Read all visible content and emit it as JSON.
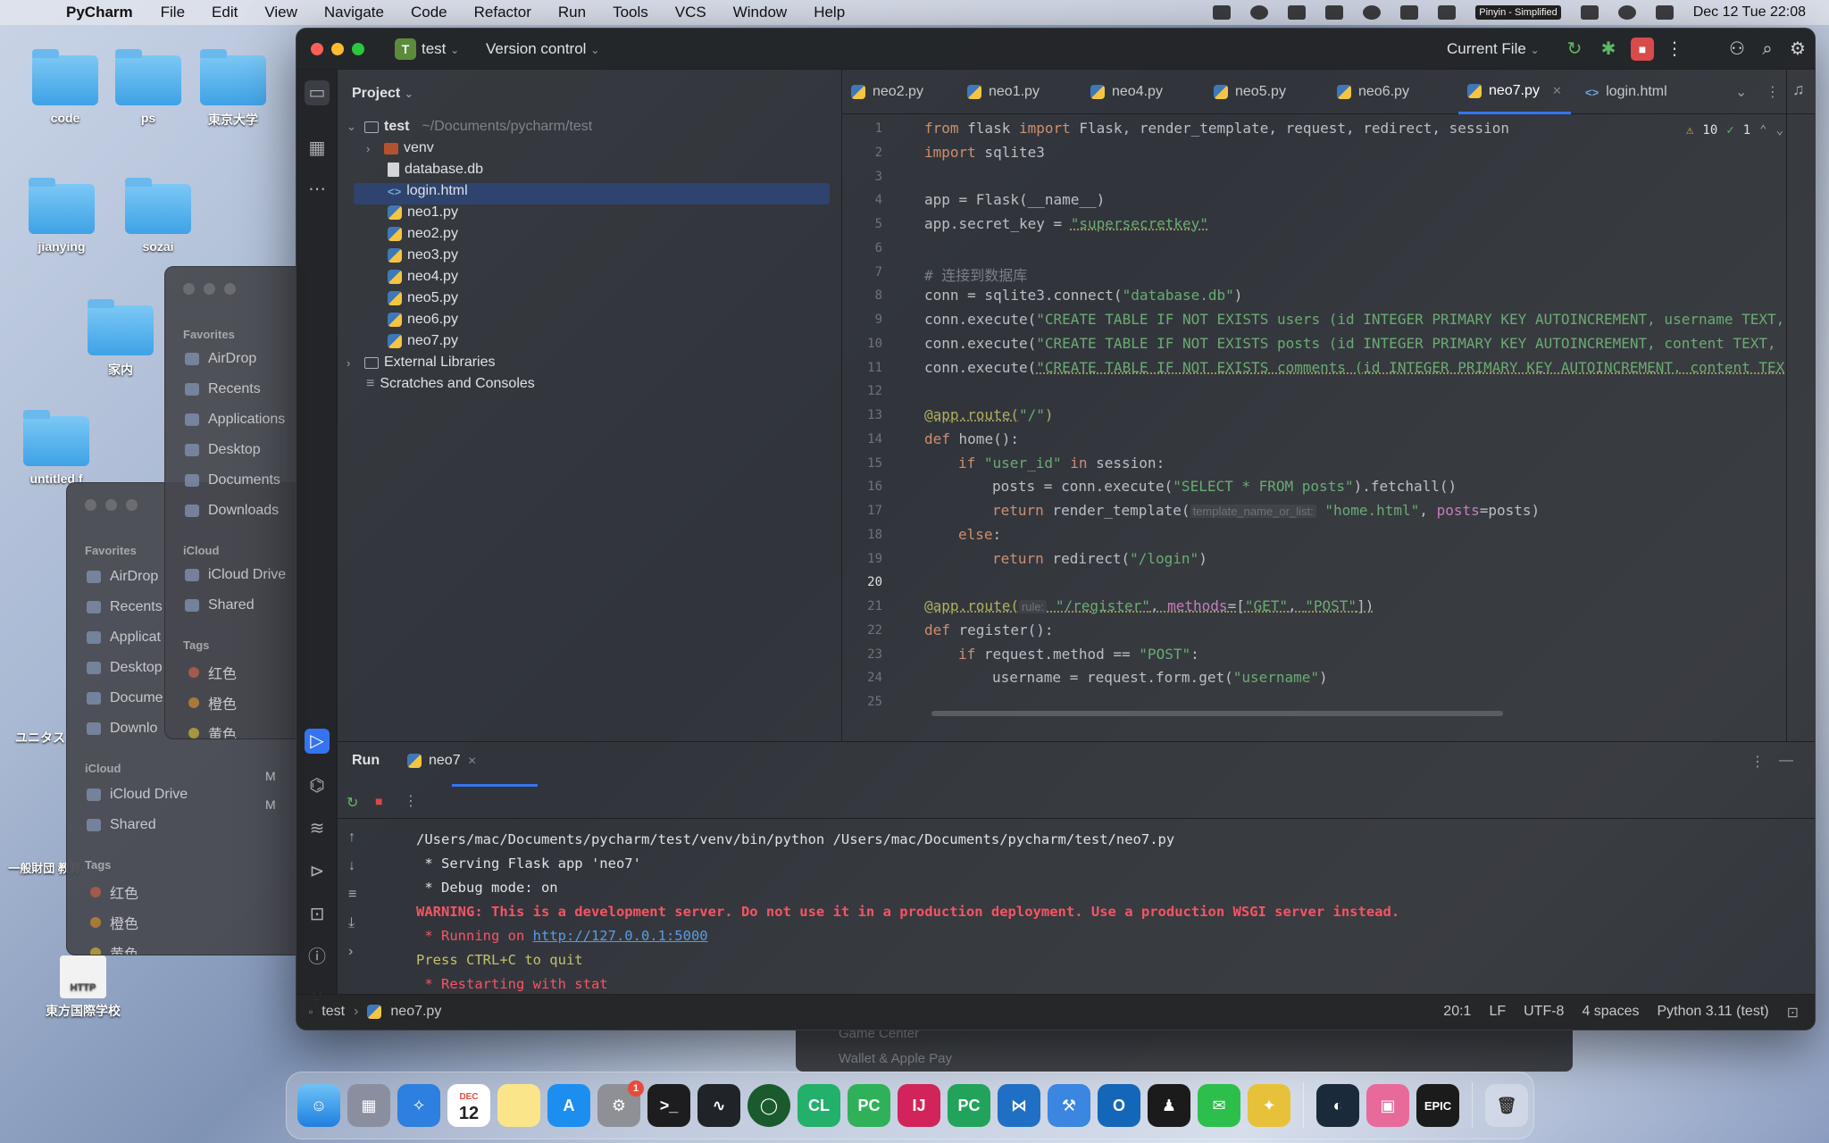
{
  "menubar": {
    "app_name": "PyCharm",
    "menus": [
      "File",
      "Edit",
      "View",
      "Navigate",
      "Code",
      "Refactor",
      "Run",
      "Tools",
      "VCS",
      "Window",
      "Help"
    ],
    "input_method": "Pinyin - Simplified",
    "datetime": "Dec 12 Tue  22:08"
  },
  "desktop": {
    "icons": [
      "code",
      "ps",
      "東京大学",
      "jianying",
      "sozai",
      "家内",
      "untitled f",
      "ユニタス",
      "一般財団 教育",
      "東方国際学校"
    ],
    "http_label": "HTTP"
  },
  "finder_back": {
    "favorites_title": "Favorites",
    "favorites": [
      "AirDrop",
      "Recents",
      "Applicat",
      "Desktop",
      "Docume",
      "Downlo"
    ],
    "icloud_title": "iCloud",
    "icloud": [
      "iCloud Drive",
      "Shared"
    ],
    "tags_title": "Tags",
    "tags": [
      "红色",
      "橙色",
      "黄色"
    ],
    "tree_letters": [
      "M",
      "M"
    ]
  },
  "finder_front": {
    "favorites_title": "Favorites",
    "favorites": [
      "AirDrop",
      "Recents",
      "Applications",
      "Desktop",
      "Documents",
      "Downloads"
    ],
    "icloud_title": "iCloud",
    "icloud": [
      "iCloud Drive",
      "Shared"
    ],
    "tags_title": "Tags",
    "tags": [
      "红色",
      "橙色",
      "黄色"
    ]
  },
  "ide": {
    "project_badge": "T",
    "project_name": "test",
    "version_control": "Version control",
    "run_config": "Current File",
    "project_panel_title": "Project",
    "tree": {
      "root": "test",
      "root_path": "~/Documents/pycharm/test",
      "items": [
        "venv",
        "database.db",
        "login.html",
        "neo1.py",
        "neo2.py",
        "neo3.py",
        "neo4.py",
        "neo5.py",
        "neo6.py",
        "neo7.py"
      ],
      "external": "External Libraries",
      "scratches": "Scratches and Consoles"
    },
    "tabs": [
      "neo2.py",
      "neo1.py",
      "neo4.py",
      "neo5.py",
      "neo6.py",
      "neo7.py",
      "login.html"
    ],
    "active_tab": "neo7.py",
    "inspections": {
      "warnings": "10",
      "ok": "1"
    },
    "line_numbers": [
      "1",
      "2",
      "3",
      "4",
      "5",
      "6",
      "7",
      "8",
      "9",
      "10",
      "11",
      "12",
      "13",
      "14",
      "15",
      "16",
      "17",
      "18",
      "19",
      "20",
      "21",
      "22",
      "23",
      "24",
      "25"
    ],
    "current_line": "20",
    "code": {
      "l1": {
        "k1": "from",
        "t1": " flask ",
        "k2": "import",
        "t2": " Flask, render_template, request, redirect, session"
      },
      "l2": {
        "k1": "import",
        "t1": " sqlite3"
      },
      "l4": "app = Flask(__name__)",
      "l5": {
        "t1": "app.secret_key = ",
        "s1": "\"supersecretkey\""
      },
      "l7": "# 连接到数据库",
      "l8": {
        "t1": "conn = sqlite3.connect(",
        "s1": "\"database.db\"",
        "t2": ")"
      },
      "l9": {
        "t1": "conn.execute(",
        "s1": "\"CREATE TABLE IF NOT EXISTS users (id INTEGER PRIMARY KEY AUTOINCREMENT, username TEXT,"
      },
      "l10": {
        "t1": "conn.execute(",
        "s1": "\"CREATE TABLE IF NOT EXISTS posts (id INTEGER PRIMARY KEY AUTOINCREMENT, content TEXT,"
      },
      "l11": {
        "t1": "conn.execute(",
        "s1": "\"CREATE TABLE IF NOT EXISTS comments (id INTEGER PRIMARY KEY AUTOINCREMENT, content TEX"
      },
      "l13": {
        "d1": "@app.route(",
        "s1": "\"/\"",
        "d2": ")"
      },
      "l14": {
        "k1": "def",
        "t1": " home():"
      },
      "l15": {
        "k1": "if",
        "s1": " \"user_id\"",
        "k2": " in",
        "t1": " session:"
      },
      "l16": {
        "t1": "posts = conn.execute(",
        "s1": "\"SELECT * FROM posts\"",
        "t2": ").fetchall()"
      },
      "l17": {
        "k1": "return",
        "t1": " render_template(",
        "h1": "template_name_or_list:",
        "s1": " \"home.html\"",
        "t2": ", ",
        "p1": "posts",
        "t3": "=posts)"
      },
      "l18": {
        "k1": "else",
        "t1": ":"
      },
      "l19": {
        "k1": "return",
        "t1": " redirect(",
        "s1": "\"/login\"",
        "t2": ")"
      },
      "l21": {
        "d1": "@app.route(",
        "h1": "rule:",
        "s1": " \"/register\"",
        "t1": ", ",
        "p1": "methods",
        "t2": "=[",
        "s2": "\"GET\"",
        "t3": ", ",
        "s3": "\"POST\"",
        "t4": "])"
      },
      "l22": {
        "k1": "def",
        "t1": " register():"
      },
      "l23": {
        "k1": "if",
        "t1": " request.method == ",
        "s1": "\"POST\"",
        "t2": ":"
      },
      "l24": {
        "t1": "username = request.form.get(",
        "s1": "\"username\"",
        "t2": ")"
      }
    },
    "run": {
      "title": "Run",
      "tab": "neo7",
      "lines": {
        "cmd": "/Users/mac/Documents/pycharm/test/venv/bin/python /Users/mac/Documents/pycharm/test/neo7.py",
        "serving": " * Serving Flask app 'neo7'",
        "debug": " * Debug mode: on",
        "warning": "WARNING: This is a development server. Do not use it in a production deployment. Use a production WSGI server instead.",
        "running_prefix": " * Running on ",
        "url": "http://127.0.0.1:5000",
        "quit": "Press CTRL+C to quit",
        "restart": " * Restarting with stat"
      }
    },
    "status": {
      "breadcrumb_project": "test",
      "breadcrumb_file": "neo7.py",
      "position": "20:1",
      "line_sep": "LF",
      "encoding": "UTF-8",
      "indent": "4 spaces",
      "interpreter": "Python 3.11 (test)"
    }
  },
  "behind_window": {
    "item1": "Game Center",
    "item2": "Wallet & Apple Pay"
  },
  "dock": {
    "calendar_month": "DEC",
    "calendar_day": "12",
    "settings_badge": "1",
    "labels": {
      "clion": "CL",
      "pycharm_pro": "PC",
      "intellij": "IJ",
      "pycharm_ce": "PC",
      "epic": "EPIC"
    }
  }
}
